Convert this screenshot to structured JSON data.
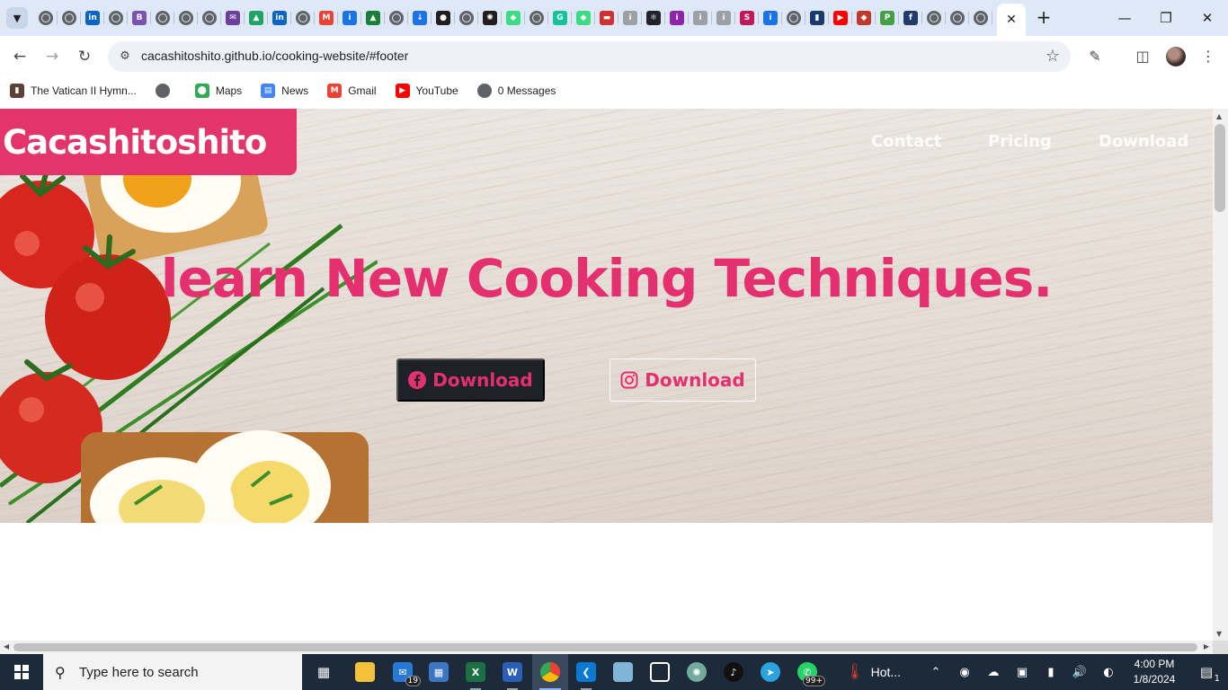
{
  "browser": {
    "tabs": [
      {
        "icon": "chrome-icon",
        "color": "#5f6368",
        "glyph": ""
      },
      {
        "icon": "openai-icon",
        "color": "#5f6368",
        "glyph": ""
      },
      {
        "icon": "linkedin-icon",
        "color": "#0a66c2",
        "glyph": "in"
      },
      {
        "icon": "globe-icon",
        "color": "#5f6368",
        "glyph": ""
      },
      {
        "icon": "bootstrap-icon",
        "color": "#7952b3",
        "glyph": "B"
      },
      {
        "icon": "settings-icon",
        "color": "#9aa0a6",
        "glyph": ""
      },
      {
        "icon": "globe-icon",
        "color": "#5f6368",
        "glyph": ""
      },
      {
        "icon": "globe-icon",
        "color": "#5f6368",
        "glyph": ""
      },
      {
        "icon": "mail-icon",
        "color": "#6b3fa0",
        "glyph": "✉"
      },
      {
        "icon": "drive-icon",
        "color": "#1fa463",
        "glyph": "▲"
      },
      {
        "icon": "linkedin-icon",
        "color": "#0a66c2",
        "glyph": "in"
      },
      {
        "icon": "globe-icon",
        "color": "#5f6368",
        "glyph": ""
      },
      {
        "icon": "gmail-icon",
        "color": "#ea4335",
        "glyph": "M"
      },
      {
        "icon": "info-icon",
        "color": "#1a73e8",
        "glyph": "i"
      },
      {
        "icon": "drive-icon",
        "color": "#188038",
        "glyph": "▲"
      },
      {
        "icon": "globe-icon",
        "color": "#5f6368",
        "glyph": ""
      },
      {
        "icon": "download-icon",
        "color": "#1a73e8",
        "glyph": "↓"
      },
      {
        "icon": "github-icon",
        "color": "#1f1f1f",
        "glyph": "●"
      },
      {
        "icon": "settings-icon",
        "color": "#9aa0a6",
        "glyph": ""
      },
      {
        "icon": "chatgpt-icon",
        "color": "#1f1f1f",
        "glyph": "✺"
      },
      {
        "icon": "android-icon",
        "color": "#3ddc84",
        "glyph": "◆"
      },
      {
        "icon": "globe-icon",
        "color": "#5f6368",
        "glyph": ""
      },
      {
        "icon": "grammarly-icon",
        "color": "#15c39a",
        "glyph": "G"
      },
      {
        "icon": "android-icon",
        "color": "#3ddc84",
        "glyph": "◆"
      },
      {
        "icon": "flag-icon",
        "color": "#d32f2f",
        "glyph": "▬"
      },
      {
        "icon": "info-icon",
        "color": "#9aa0a6",
        "glyph": "i"
      },
      {
        "icon": "react-icon",
        "color": "#20232a",
        "glyph": "⚛"
      },
      {
        "icon": "info-icon",
        "color": "#8e24aa",
        "glyph": "i"
      },
      {
        "icon": "info-icon",
        "color": "#9aa0a6",
        "glyph": "i"
      },
      {
        "icon": "info-icon",
        "color": "#9aa0a6",
        "glyph": "i"
      },
      {
        "icon": "s-icon",
        "color": "#c2185b",
        "glyph": "S"
      },
      {
        "icon": "info-icon",
        "color": "#1a73e8",
        "glyph": "i"
      },
      {
        "icon": "settings-icon",
        "color": "#9aa0a6",
        "glyph": ""
      },
      {
        "icon": "bookmark-icon",
        "color": "#1a3a6b",
        "glyph": "▮"
      },
      {
        "icon": "youtube-icon",
        "color": "#ff0000",
        "glyph": "▶"
      },
      {
        "icon": "shield-icon",
        "color": "#c0392b",
        "glyph": "◆"
      },
      {
        "icon": "puzzle-icon",
        "color": "#43a047",
        "glyph": "P"
      },
      {
        "icon": "facebook-icon",
        "color": "#1f3a6b",
        "glyph": "f"
      },
      {
        "icon": "globe-icon",
        "color": "#5f6368",
        "glyph": ""
      },
      {
        "icon": "globe-icon",
        "color": "#5f6368",
        "glyph": ""
      },
      {
        "icon": "globe-icon",
        "color": "#5f6368",
        "glyph": ""
      }
    ],
    "url": "cacashitoshito.github.io/cooking-website/#footer",
    "bookmarks": [
      {
        "label": "The Vatican II Hymn...",
        "icon": "hymnal-icon",
        "color": "#5d4037",
        "glyph": "▮"
      },
      {
        "label": "",
        "icon": "globe-icon",
        "color": "#5f6368",
        "glyph": ""
      },
      {
        "label": "Maps",
        "icon": "maps-icon",
        "color": "#34a853",
        "glyph": "⬤"
      },
      {
        "label": "News",
        "icon": "news-icon",
        "color": "#4285f4",
        "glyph": "▤"
      },
      {
        "label": "Gmail",
        "icon": "gmail-icon",
        "color": "#ea4335",
        "glyph": "M"
      },
      {
        "label": "YouTube",
        "icon": "youtube-icon",
        "color": "#ff0000",
        "glyph": "▶"
      },
      {
        "label": "0 Messages",
        "icon": "globe-icon",
        "color": "#5f6368",
        "glyph": ""
      }
    ]
  },
  "site": {
    "brand": "Cacashitoshito",
    "nav": [
      "Contact",
      "Pricing",
      "Download"
    ],
    "headline": "learn New Cooking Techniques.",
    "buttons": [
      {
        "label": "Download",
        "icon": "facebook-icon"
      },
      {
        "label": "Download",
        "icon": "instagram-icon"
      }
    ],
    "accent": "#e5306f"
  },
  "taskbar": {
    "search_placeholder": "Type here to search",
    "mail_badge": "19",
    "whatsapp_badge": "99+",
    "weather": "Hot...",
    "time": "4:00 PM",
    "date": "1/8/2024",
    "notifications": "1"
  }
}
